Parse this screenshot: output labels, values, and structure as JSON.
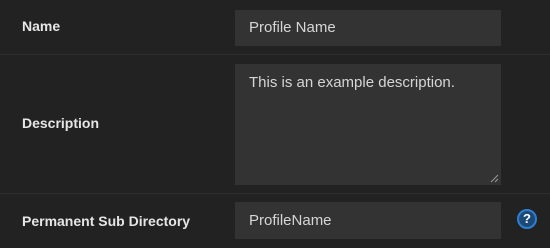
{
  "form": {
    "rows": [
      {
        "label": "Name",
        "value": "Profile Name"
      },
      {
        "label": "Description",
        "value": "This is an example description."
      },
      {
        "label": "Permanent Sub Directory",
        "value": "ProfileName"
      }
    ],
    "help_icon_glyph": "?"
  },
  "colors": {
    "background": "#222222",
    "field_background": "#333333",
    "label_text": "#e6e6e6",
    "value_text": "#d6d6d6",
    "help_icon_fill": "#1b4a78",
    "help_icon_ring": "#2f7fd0"
  },
  "icons": {
    "help": "help-icon",
    "resize": "resize-grip-icon"
  }
}
